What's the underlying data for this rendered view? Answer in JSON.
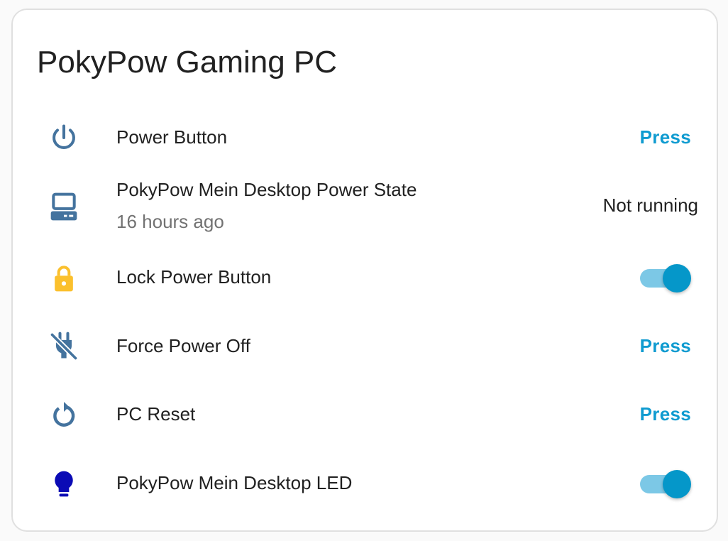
{
  "card": {
    "title": "PokyPow Gaming PC"
  },
  "rows": [
    {
      "label": "Power Button",
      "action": "Press",
      "icon": "power-icon"
    },
    {
      "label": "PokyPow Mein Desktop Power State",
      "secondary": "16 hours ago",
      "state": "Not running",
      "icon": "desktop-tower-icon"
    },
    {
      "label": "Lock Power Button",
      "toggle": true,
      "icon": "lock-icon"
    },
    {
      "label": "Force Power Off",
      "action": "Press",
      "icon": "power-plug-off-icon"
    },
    {
      "label": "PC Reset",
      "action": "Press",
      "icon": "restart-icon"
    },
    {
      "label": "PokyPow Mein Desktop LED",
      "toggle": true,
      "icon": "lightbulb-icon"
    }
  ],
  "colors": {
    "accent": "#0f9bd0",
    "icon_default": "#44739e",
    "lock_icon": "#fbc02d",
    "led_icon": "#0b0bb5",
    "toggle_track": "#7cc8e6",
    "toggle_knob": "#0597c9"
  }
}
